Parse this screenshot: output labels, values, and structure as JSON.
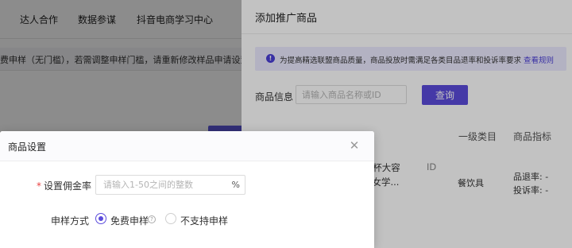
{
  "top_nav": {
    "items": [
      "达人合作",
      "数据参谋",
      "抖音电商学习中心"
    ]
  },
  "background_notice": {
    "text": "费申样（无门槛），若需调整申样门槛，请重新修改样品申请设置"
  },
  "drawer": {
    "title": "添加推广商品",
    "notice": {
      "icon": "info-icon",
      "text": "为提高精选联盟商品质量，商品投放时需满足各类目品退率和投诉率要求",
      "link": "查看规则"
    },
    "search": {
      "label": "商品信息",
      "placeholder": "请输入商品名称或ID",
      "button": "查询"
    },
    "columns": {
      "category": "一级类目",
      "metrics": "商品指标"
    },
    "product": {
      "name_line_1": "gins水杯大容",
      "name_line_2": "杯子男女学...",
      "id_label": "ID",
      "category": "餐饮具",
      "metric_1": "品退率: -",
      "metric_2": "投诉率: -"
    }
  },
  "modal": {
    "title": "商品设置",
    "close_icon": "close-icon",
    "commission": {
      "required_mark": "*",
      "label": "设置佣金率",
      "placeholder": "请输入1-50之间的整数",
      "suffix": "%"
    },
    "sample": {
      "label": "申样方式",
      "options": [
        {
          "label": "免费申样",
          "checked": true
        },
        {
          "label": "不支持申样",
          "checked": false
        }
      ],
      "help_icon": "help-circle-icon"
    }
  },
  "colors": {
    "accent": "#5b4bdc",
    "notice_bg": "#eceaff",
    "required": "#e94141"
  }
}
